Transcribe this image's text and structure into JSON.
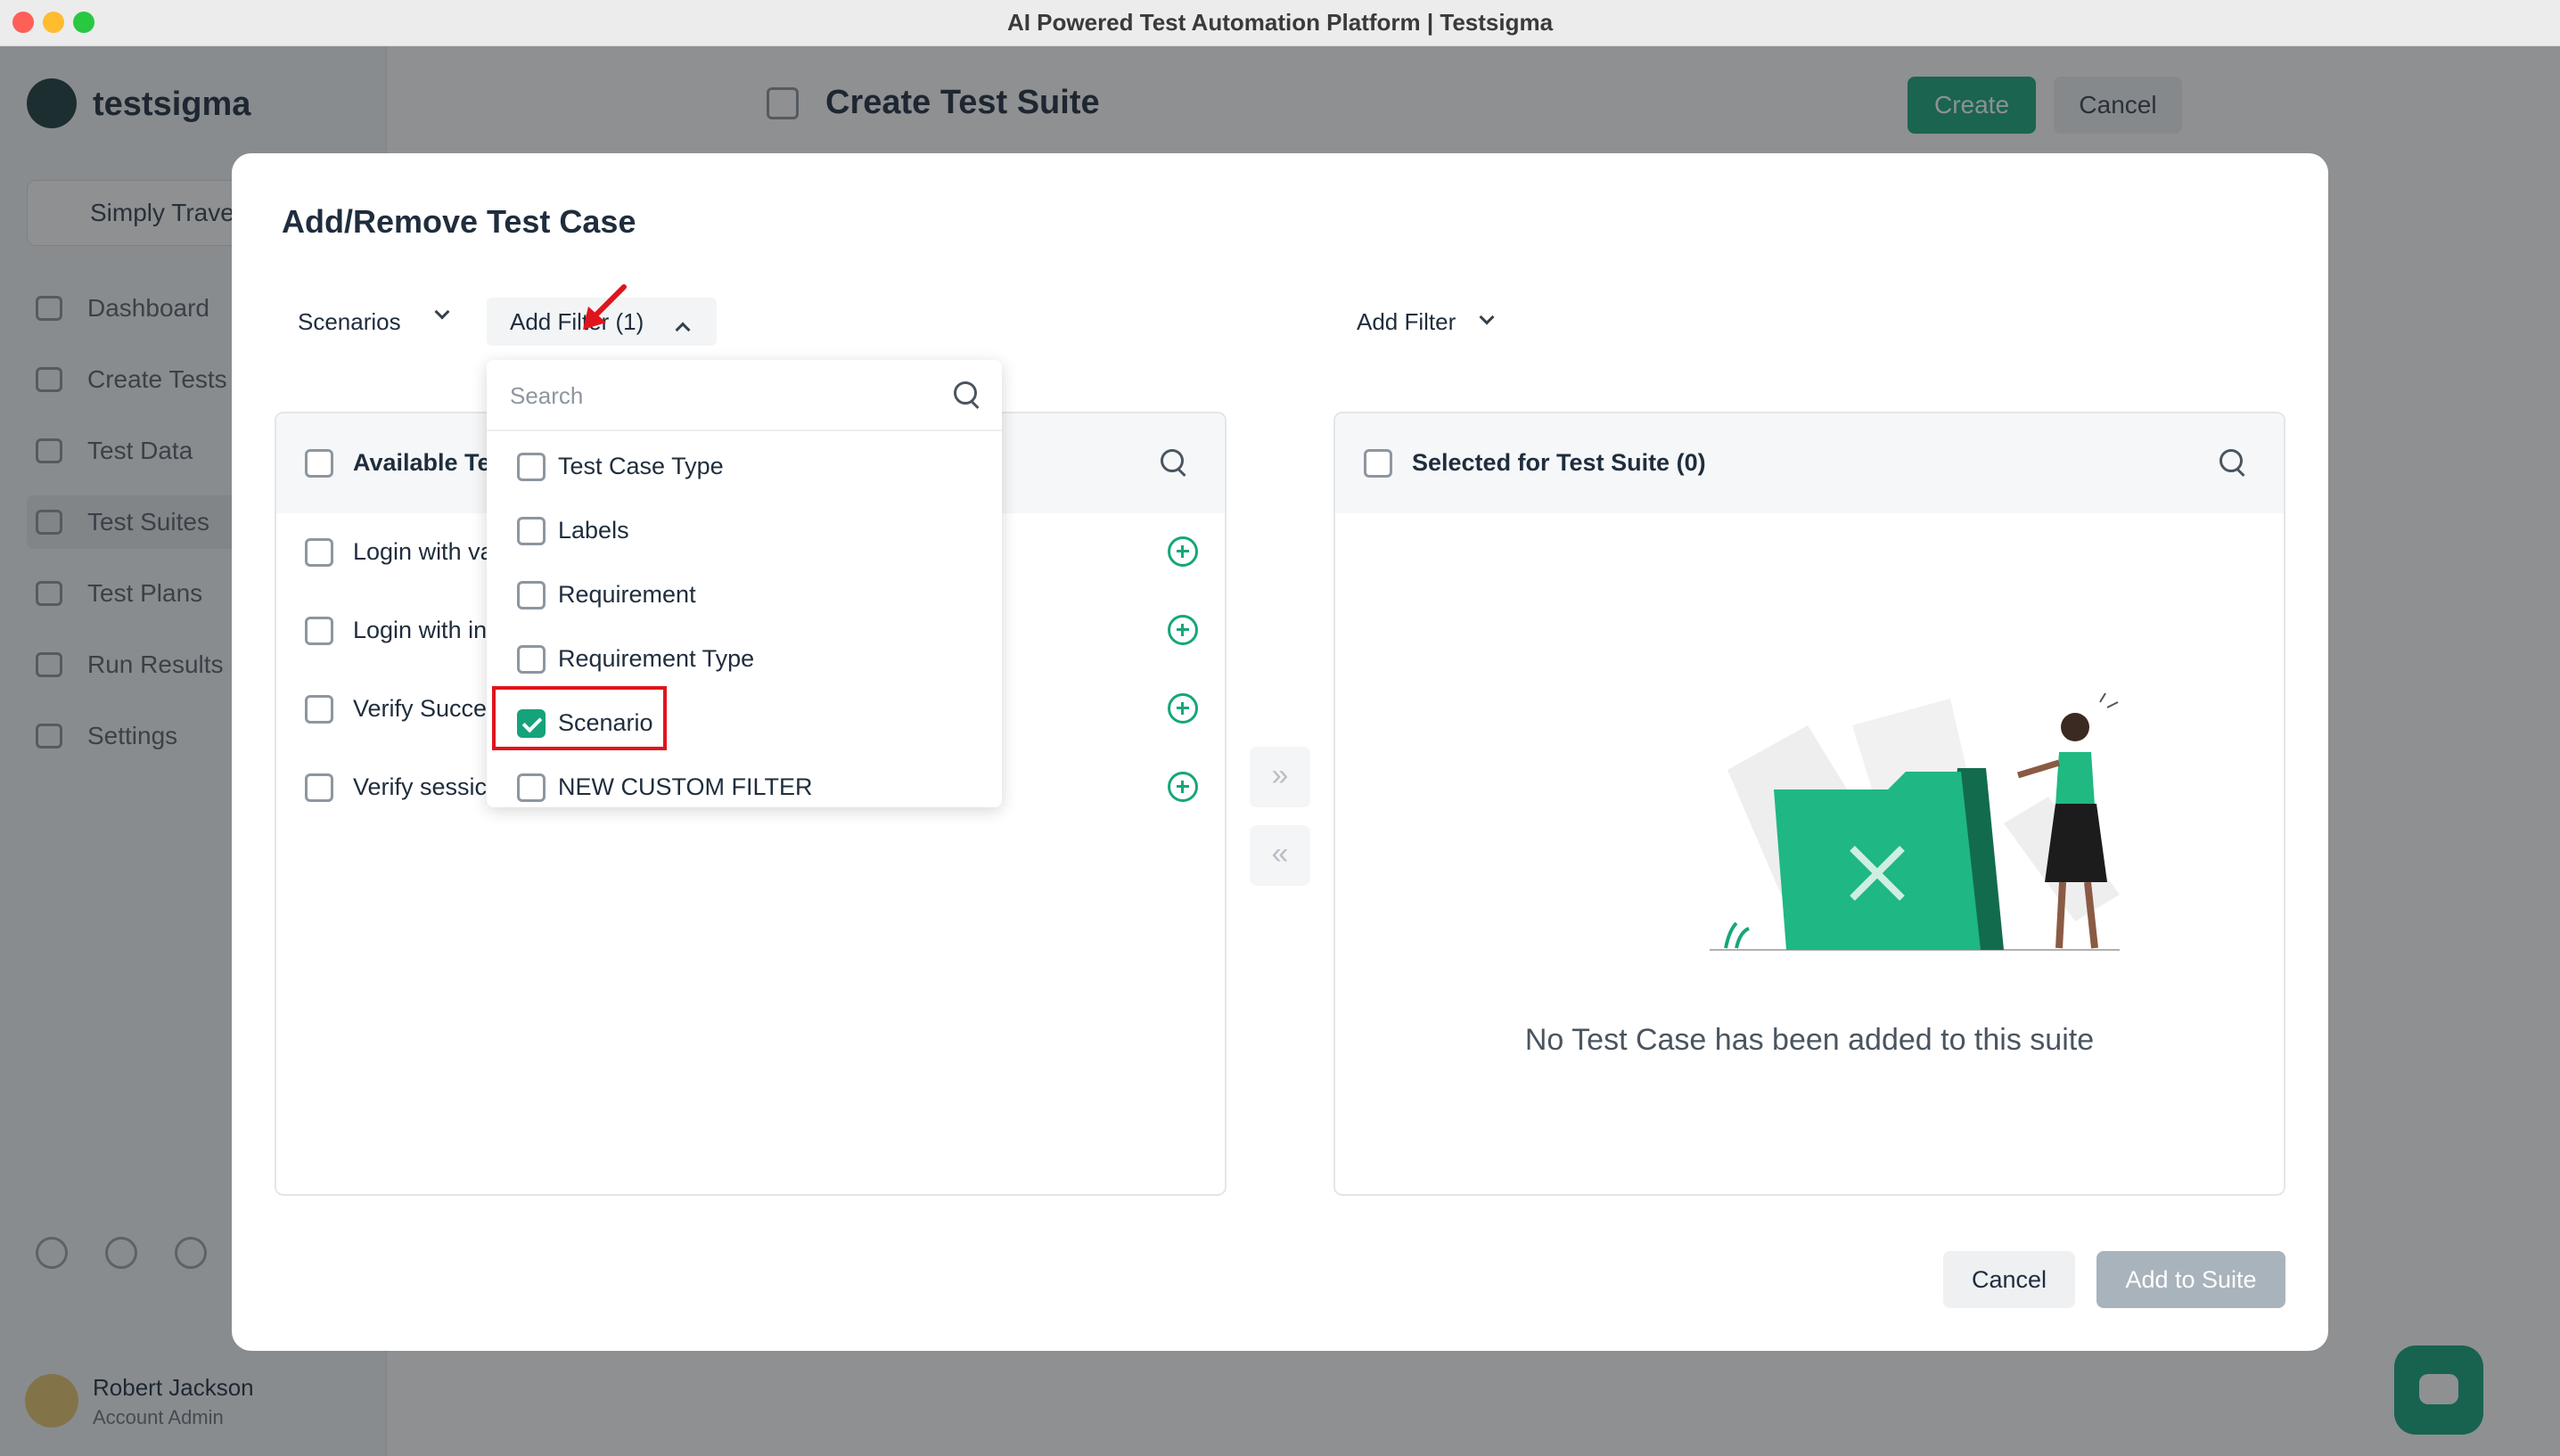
{
  "window": {
    "title": "AI Powered Test Automation Platform | Testsigma"
  },
  "app": {
    "brand": "testsigma",
    "project": "Simply Travel",
    "nav": [
      "Dashboard",
      "Create Tests",
      "Test Data",
      "Test Suites",
      "Test Plans",
      "Run Results",
      "Settings"
    ],
    "page_title": "Create Test Suite",
    "create_label": "Create",
    "cancel_label": "Cancel",
    "user_name": "Robert Jackson",
    "user_role": "Account Admin"
  },
  "modal": {
    "title": "Add/Remove Test Case",
    "scenarios_label": "Scenarios",
    "add_filter_left_label": "Add Filter (1)",
    "add_filter_right_label": "Add Filter",
    "dropdown": {
      "search_placeholder": "Search",
      "options": [
        {
          "label": "Test Case Type",
          "checked": false
        },
        {
          "label": "Labels",
          "checked": false
        },
        {
          "label": "Requirement",
          "checked": false
        },
        {
          "label": "Requirement Type",
          "checked": false
        },
        {
          "label": "Scenario",
          "checked": true
        },
        {
          "label": "NEW CUSTOM FILTER",
          "checked": false
        }
      ]
    },
    "left_panel": {
      "header": "Available Te",
      "rows": [
        "Login with va",
        "Login with in",
        "Verify Succe",
        "Verify sessic"
      ]
    },
    "transfer": {
      "move_right": "»",
      "move_left": "«"
    },
    "right_panel": {
      "header": "Selected for Test Suite (0)",
      "empty_text": "No Test Case has been added to this suite"
    },
    "footer": {
      "cancel_label": "Cancel",
      "add_label": "Add to Suite"
    }
  },
  "colors": {
    "accent": "#16a67a",
    "highlight": "#e0141c",
    "disabled_button": "#a9b3bc"
  }
}
